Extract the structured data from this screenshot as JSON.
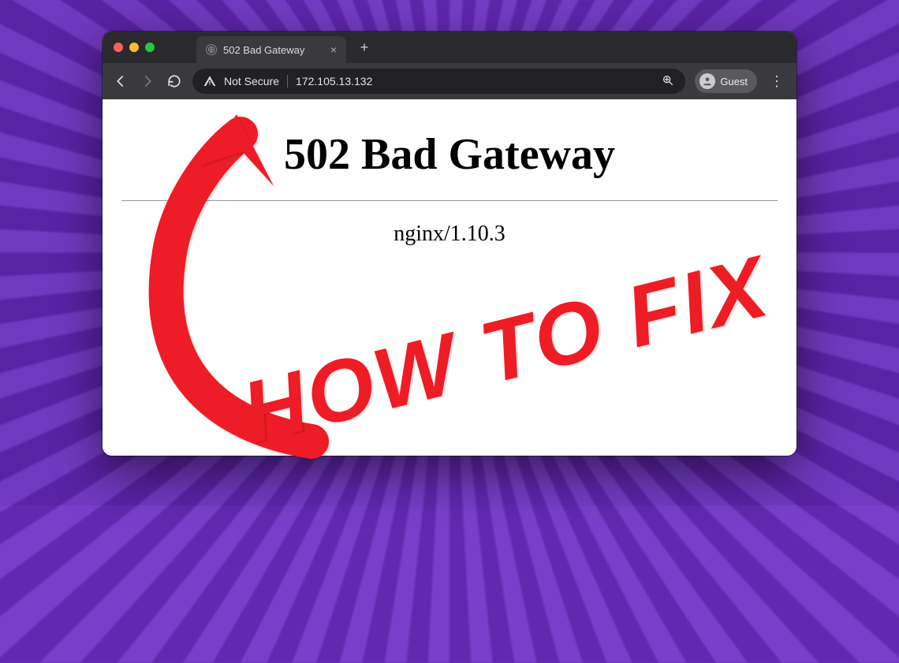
{
  "browser": {
    "tab": {
      "title": "502 Bad Gateway"
    },
    "security_label": "Not Secure",
    "address": "172.105.13.132",
    "user_chip": "Guest"
  },
  "page": {
    "heading": "502 Bad Gateway",
    "server_line": "nginx/1.10.3"
  },
  "annotation": {
    "text": "HOW TO FIX"
  }
}
